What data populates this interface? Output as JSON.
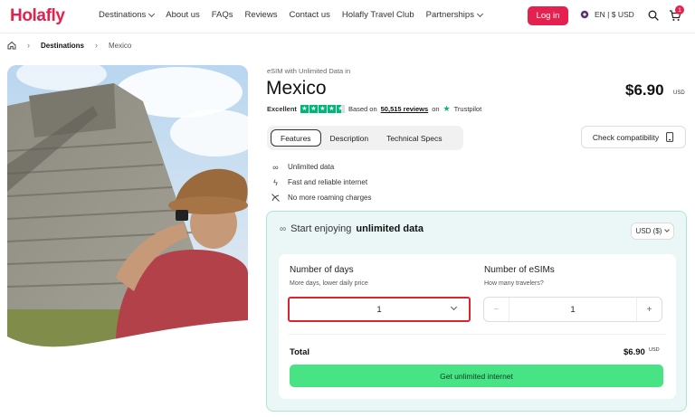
{
  "header": {
    "logo": "Holafly",
    "nav": [
      "Destinations",
      "About us",
      "FAQs",
      "Reviews",
      "Contact us",
      "Holafly Travel Club",
      "Partnerships"
    ],
    "login_label": "Log in",
    "locale_label": "EN | $ USD",
    "cart_count": "1",
    "icons": {
      "search": "search-icon",
      "cart": "cart-icon",
      "flag": "uk-flag-icon"
    },
    "accent_color": "#e5214f"
  },
  "breadcrumb": {
    "items": [
      "Destinations",
      "Mexico"
    ]
  },
  "product": {
    "subtitle": "eSIM with Unlimited Data in",
    "title": "Mexico",
    "price": "$6.90",
    "price_currency": "USD",
    "rating": {
      "label": "Excellent",
      "prefix": "Based on",
      "count": "50,515 reviews",
      "suffix": "on",
      "brand": "Trustpilot",
      "stars": 4.5
    }
  },
  "tabs": {
    "items": [
      "Features",
      "Description",
      "Technical Specs"
    ],
    "active": "Features"
  },
  "check_compatibility": "Check compatibility",
  "features": [
    {
      "icon": "infinity-icon",
      "text": "Unlimited data"
    },
    {
      "icon": "lightning-icon",
      "text": "Fast and reliable internet"
    },
    {
      "icon": "no-roaming-icon",
      "text": "No more roaming charges"
    }
  ],
  "plan": {
    "headline_prefix": "Start enjoying",
    "headline_bold": "unlimited data",
    "currency_select": "USD ($)",
    "days": {
      "label": "Number of days",
      "hint": "More days, lower daily price",
      "value": "1"
    },
    "esims": {
      "label": "Number of eSIMs",
      "hint": "How many travelers?",
      "value": "1",
      "minus": "−",
      "plus": "+"
    },
    "total_label": "Total",
    "total_price": "$6.90",
    "total_currency": "USD",
    "cta_label": "Get unlimited internet",
    "card_bg": "#eaf7f6",
    "cta_color": "#48e384"
  }
}
